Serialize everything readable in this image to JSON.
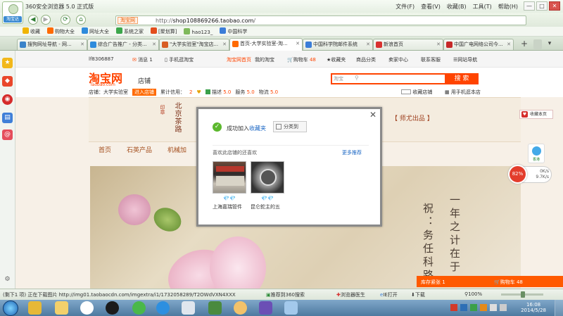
{
  "window": {
    "title": "360安全浏览器 5.0 正式版"
  },
  "menu": [
    "文件(F)",
    "查看(V)",
    "收藏(B)",
    "工具(T)",
    "帮助(H)"
  ],
  "window_controls": {
    "min": "—",
    "max": "□",
    "close": "✕"
  },
  "nav": {
    "avatar_label": "淘宝达",
    "back": "◀",
    "forward": "▶",
    "refresh": "⟳",
    "home": "⌂",
    "site_badge": "淘宝网",
    "url_prefix": "http://",
    "url_domain": "shop108869266.taobao.com",
    "url_suffix": "/"
  },
  "favorites": [
    "收藏",
    "购物大全",
    "网址大全",
    "系统之家",
    "[聚划算]",
    "hao123_",
    "中国科学"
  ],
  "tabs": [
    {
      "label": "搜狗网址导航 - 网...",
      "color": "#3b83c9"
    },
    {
      "label": "综合广告推广 - 分类...",
      "color": "#2e8bdc"
    },
    {
      "label": "\"大学实验室\"淘宝店...",
      "color": "#d85d25"
    },
    {
      "label": "首页-大学实验室-淘...",
      "color": "#ff6a00"
    },
    {
      "label": "中国科学院邮件系统",
      "color": "#3b7dd8"
    },
    {
      "label": "新浪首页",
      "color": "#d8312f"
    },
    {
      "label": "中国广电网络公司今...",
      "color": "#c62828"
    }
  ],
  "tab_tools": {
    "add": "+",
    "menu": "▾"
  },
  "taobao_topbar": {
    "user": "lf8306887",
    "msg_label": "消息",
    "msg_count": "1",
    "mobile": "手机逛淘宝",
    "links": [
      "淘宝网首页",
      "我的淘宝",
      "购物车",
      "收藏夹",
      "商品分类",
      "卖家中心",
      "联系客服",
      "网站导航"
    ],
    "cart_count": "48"
  },
  "shop_header": {
    "logo": "淘宝网",
    "logo_sub": "Taobao.com",
    "section": "店铺",
    "search_scope": "淘宝",
    "search_btn": "搜 索",
    "shop_label": "店铺：",
    "shop_name": "大学实验室",
    "enter_btn": "进入店铺",
    "credit_label": "累计信用：",
    "credit_value": "2",
    "describe_label": "描述",
    "describe_score": "5.0",
    "service_label": "服务",
    "service_score": "5.0",
    "logistics_label": "物流",
    "logistics_score": "5.0",
    "fav_shop": "收藏店铺",
    "mobile_shop": "用手机逛本店"
  },
  "banner": {
    "calligraphy_left_1": "北京茶路",
    "calligraphy_left_2": "印章",
    "calligraphy_right": "【 师尤出品 】"
  },
  "shop_nav": [
    "首页",
    "石英产品",
    "机械加"
  ],
  "photo_poem": {
    "col1": "一年之计在于",
    "col2": "祝：务任科路"
  },
  "popup": {
    "success_icon": "✓",
    "msg_prefix": "成功加入",
    "msg_link": "收藏夹",
    "category_btn": "分类到",
    "close": "✕",
    "recommend_title": "喜欢此店铺的还喜欢",
    "more_link": "更多推荐",
    "items": [
      {
        "name": "上海嘉瑞管件",
        "diamonds": "💎💎"
      },
      {
        "name": "昆仑鉈主的五",
        "diamonds": "💎💎"
      }
    ]
  },
  "right_panel": {
    "fav_page": "收藏本页",
    "share_label": "香港",
    "speed_percent": "82%",
    "speed_up": "0K/s",
    "speed_down": "9.7K/s",
    "cart_bar_label": "库存紧张",
    "cart_bar_count": "1",
    "cart_bar_cart": "购物车",
    "cart_bar_cart_count": "48"
  },
  "status": {
    "text": "(剩下1 项) 正在下载图片 http://img01.taobaocdn.com/imgextra/i1/1732058289/T2OWdVXN4XXX",
    "push": "推荐到360搜索",
    "doctor": "浏览器医生",
    "ie": "IE打开",
    "download": "下载",
    "zoom": "100%"
  },
  "taskbar": {
    "time": "16:08",
    "date": "2014/5/28"
  }
}
